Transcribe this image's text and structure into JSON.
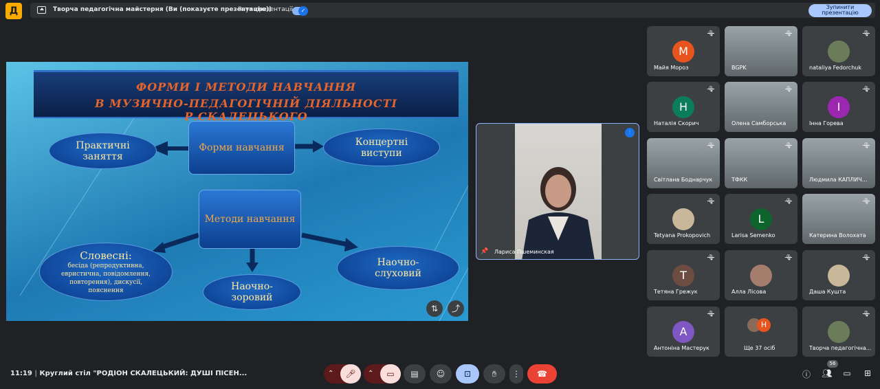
{
  "top_bar": {
    "logo": "Д",
    "presentation_title": "Творча педагогічна майстерня (Ви (показуєте презентацію))",
    "sound_label": "Звук презентації",
    "sound_on": true,
    "stop_label": "Зупинити презентацію"
  },
  "slide": {
    "title_line1": "ФОРМИ   І   МЕТОДИ   НАВЧАННЯ",
    "title_line2": "В МУЗИЧНО-ПЕДАГОГІЧНІЙ ДІЯЛЬНОСТІ Р.СКАЛЕЦЬКОГО",
    "forms_box": "Форми навчання",
    "practical": "Практичні заняття",
    "concert": "Концертні виступи",
    "methods_box": "Методи навчання",
    "verbal_title": "Словесні:",
    "verbal_detail": "бесіда (репродуктивна, евристична, повідомлення, повторення), дискусії, пояснення",
    "visual": "Наочно-зоровий",
    "auditory": "Наочно-слуховий"
  },
  "speaker": {
    "name": "Лариса Пшеминская"
  },
  "participants": [
    {
      "name": "Майя Мороз",
      "initial": "М",
      "color": "#e8541e",
      "type": "avatar"
    },
    {
      "name": "BGPK",
      "type": "video"
    },
    {
      "name": "nataliya Fedorchuk",
      "type": "photo"
    },
    {
      "name": "Наталія Скорич",
      "initial": "Н",
      "color": "#0b7d5b",
      "type": "avatar"
    },
    {
      "name": "Олена Самборська",
      "type": "video"
    },
    {
      "name": "Інна Горева",
      "initial": "І",
      "color": "#9c27b0",
      "type": "avatar"
    },
    {
      "name": "Світлана Боднарчук",
      "type": "video"
    },
    {
      "name": "ТФКК",
      "type": "video"
    },
    {
      "name": "Людмила КАПЛИЧ...",
      "type": "video"
    },
    {
      "name": "Tetyana Prokopovich",
      "type": "photo"
    },
    {
      "name": "Larisa Semenko",
      "initial": "L",
      "color": "#0d652d",
      "type": "avatar"
    },
    {
      "name": "Катерина Волохата",
      "type": "video"
    },
    {
      "name": "Тетяна Грежук",
      "initial": "Т",
      "color": "#6d4c41",
      "type": "avatar"
    },
    {
      "name": "Алла Лісова",
      "type": "photo"
    },
    {
      "name": "Даша Кушта",
      "type": "photo"
    },
    {
      "name": "Антоніна Мастерук",
      "initial": "А",
      "color": "#7e57c2",
      "type": "avatar"
    },
    {
      "name": "Ще 37 осіб",
      "initial": "Н",
      "color": "#e8541e",
      "type": "more"
    },
    {
      "name": "Творча педагогічна...",
      "type": "photo"
    }
  ],
  "bottom": {
    "time": "11:19",
    "meeting_title": "Круглий стіл \"РОДІОН СКАЛЕЦЬКИЙ: ДУШІ ПІСЕН...",
    "participants_count": "56"
  }
}
